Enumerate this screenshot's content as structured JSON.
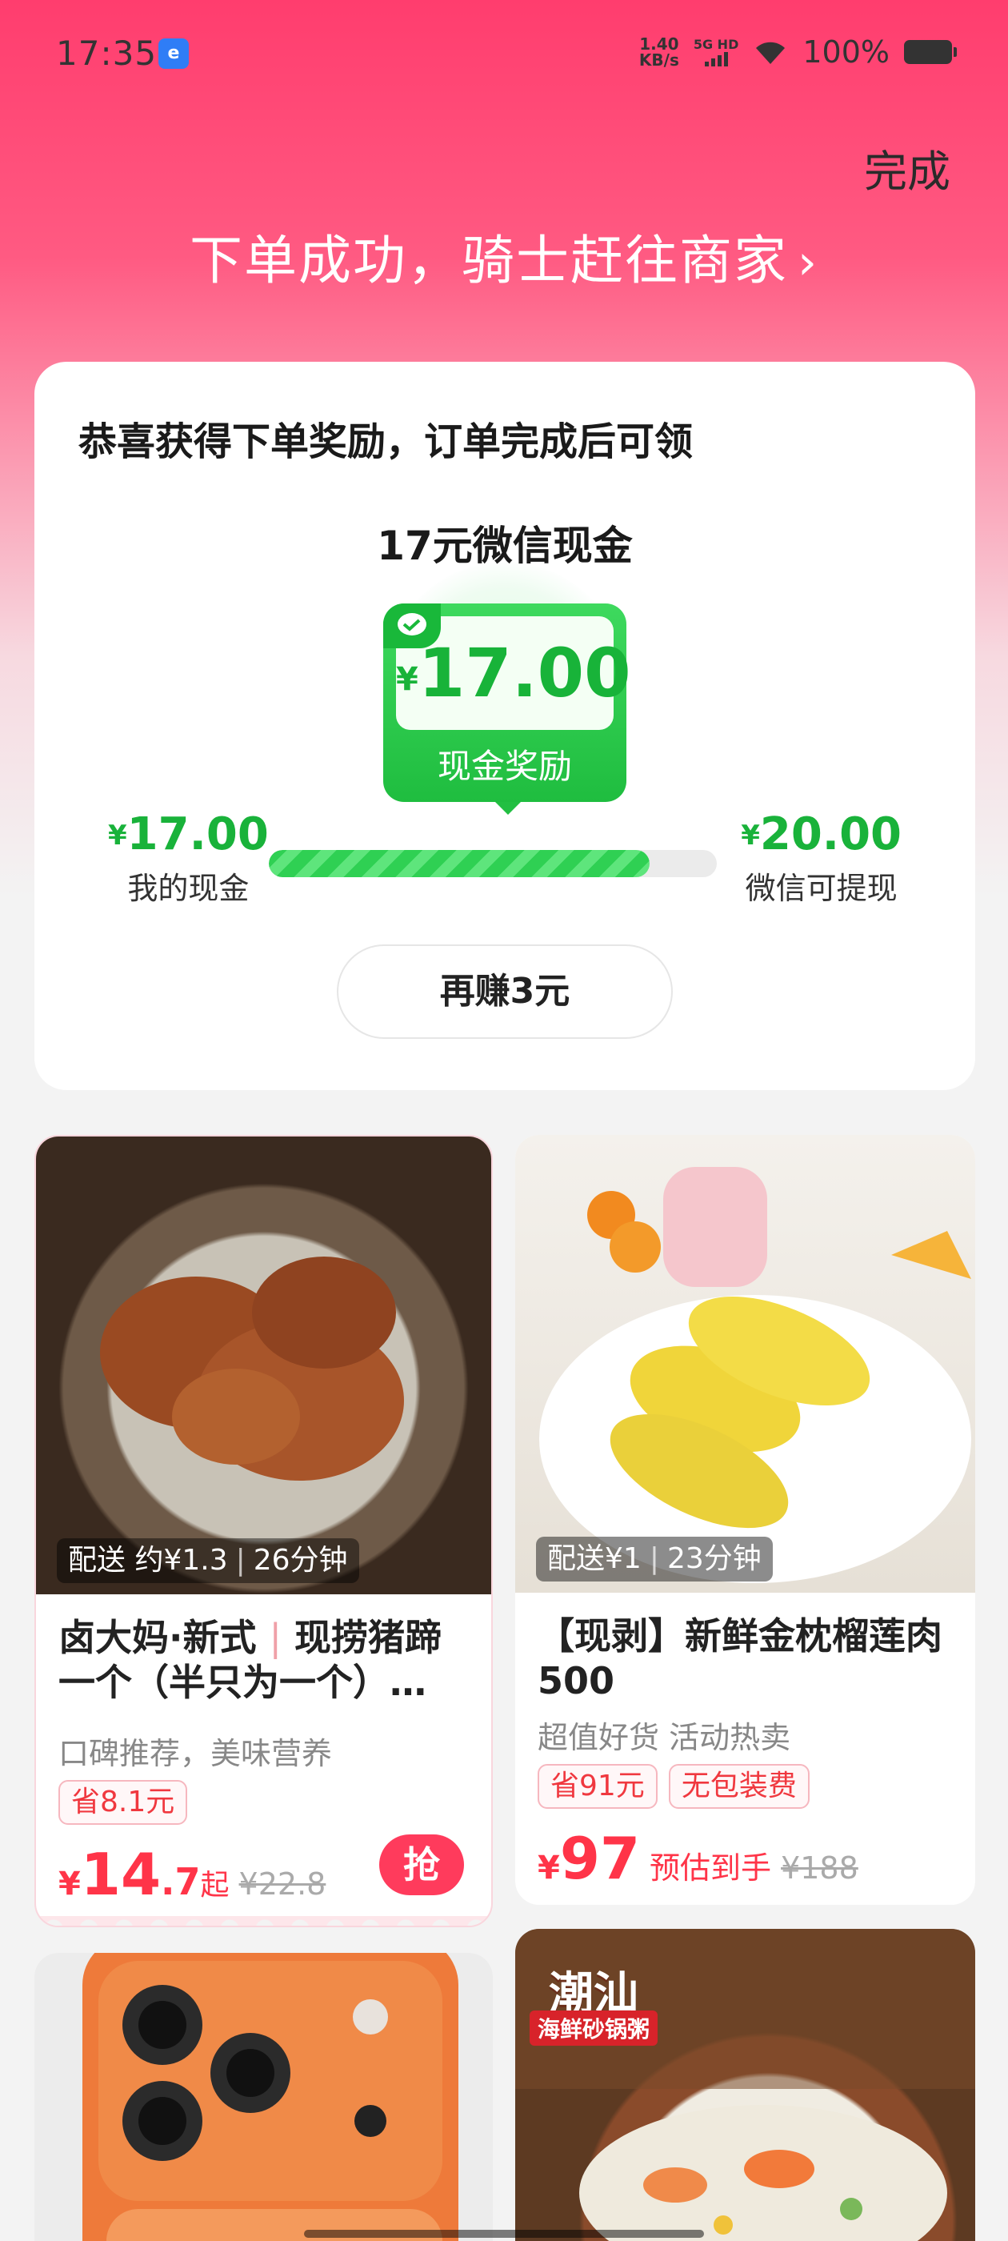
{
  "status_bar": {
    "time": "17:35",
    "net_speed_value": "1.40",
    "net_speed_unit": "KB/s",
    "network": "5G HD",
    "battery": "100%"
  },
  "header": {
    "done_label": "完成",
    "headline": "下单成功，骑士赶往商家",
    "chevron": "›"
  },
  "reward": {
    "title": "恭喜获得下单奖励，订单完成后可领",
    "amount_title": "17元微信现金",
    "badge_currency": "¥",
    "badge_amount": "17.00",
    "badge_label": "现金奖励",
    "my_cash_value": "17.00",
    "my_cash_label": "我的现金",
    "target_value": "20.00",
    "target_label": "微信可提现",
    "currency": "¥",
    "progress": 0.85,
    "earn_more_label": "再赚3元",
    "accent_color": "#19b23a"
  },
  "products": [
    {
      "delivery_fee": "配送 约¥1.3",
      "delivery_time": "26分钟",
      "brand": "卤大妈·新式",
      "title": "现捞猪蹄一个（半只为一个）…",
      "subtitle": "口碑推荐，美味营养",
      "tags": [
        "省8.1元"
      ],
      "price_currency": "¥",
      "price_int": "14",
      "price_dec": ".7",
      "price_suffix": "起",
      "original_price": "¥22.8",
      "grab_label": "抢"
    },
    {
      "delivery_fee": "配送¥1",
      "delivery_time": "23分钟",
      "title": "【现剥】新鲜金枕榴莲肉500",
      "subtitle": "超值好货 活动热卖",
      "tags": [
        "省91元",
        "无包装费"
      ],
      "price_currency": "¥",
      "price_int": "97",
      "price_note": "预估到手",
      "original_price": "¥188"
    },
    {
      "image_icon": "phone-image"
    },
    {
      "brand_text": "潮汕",
      "brand_sub": "海鲜砂锅粥"
    }
  ],
  "colors": {
    "brand_red": "#ff3d6e",
    "price_red": "#ff3448",
    "green": "#19b23a"
  }
}
